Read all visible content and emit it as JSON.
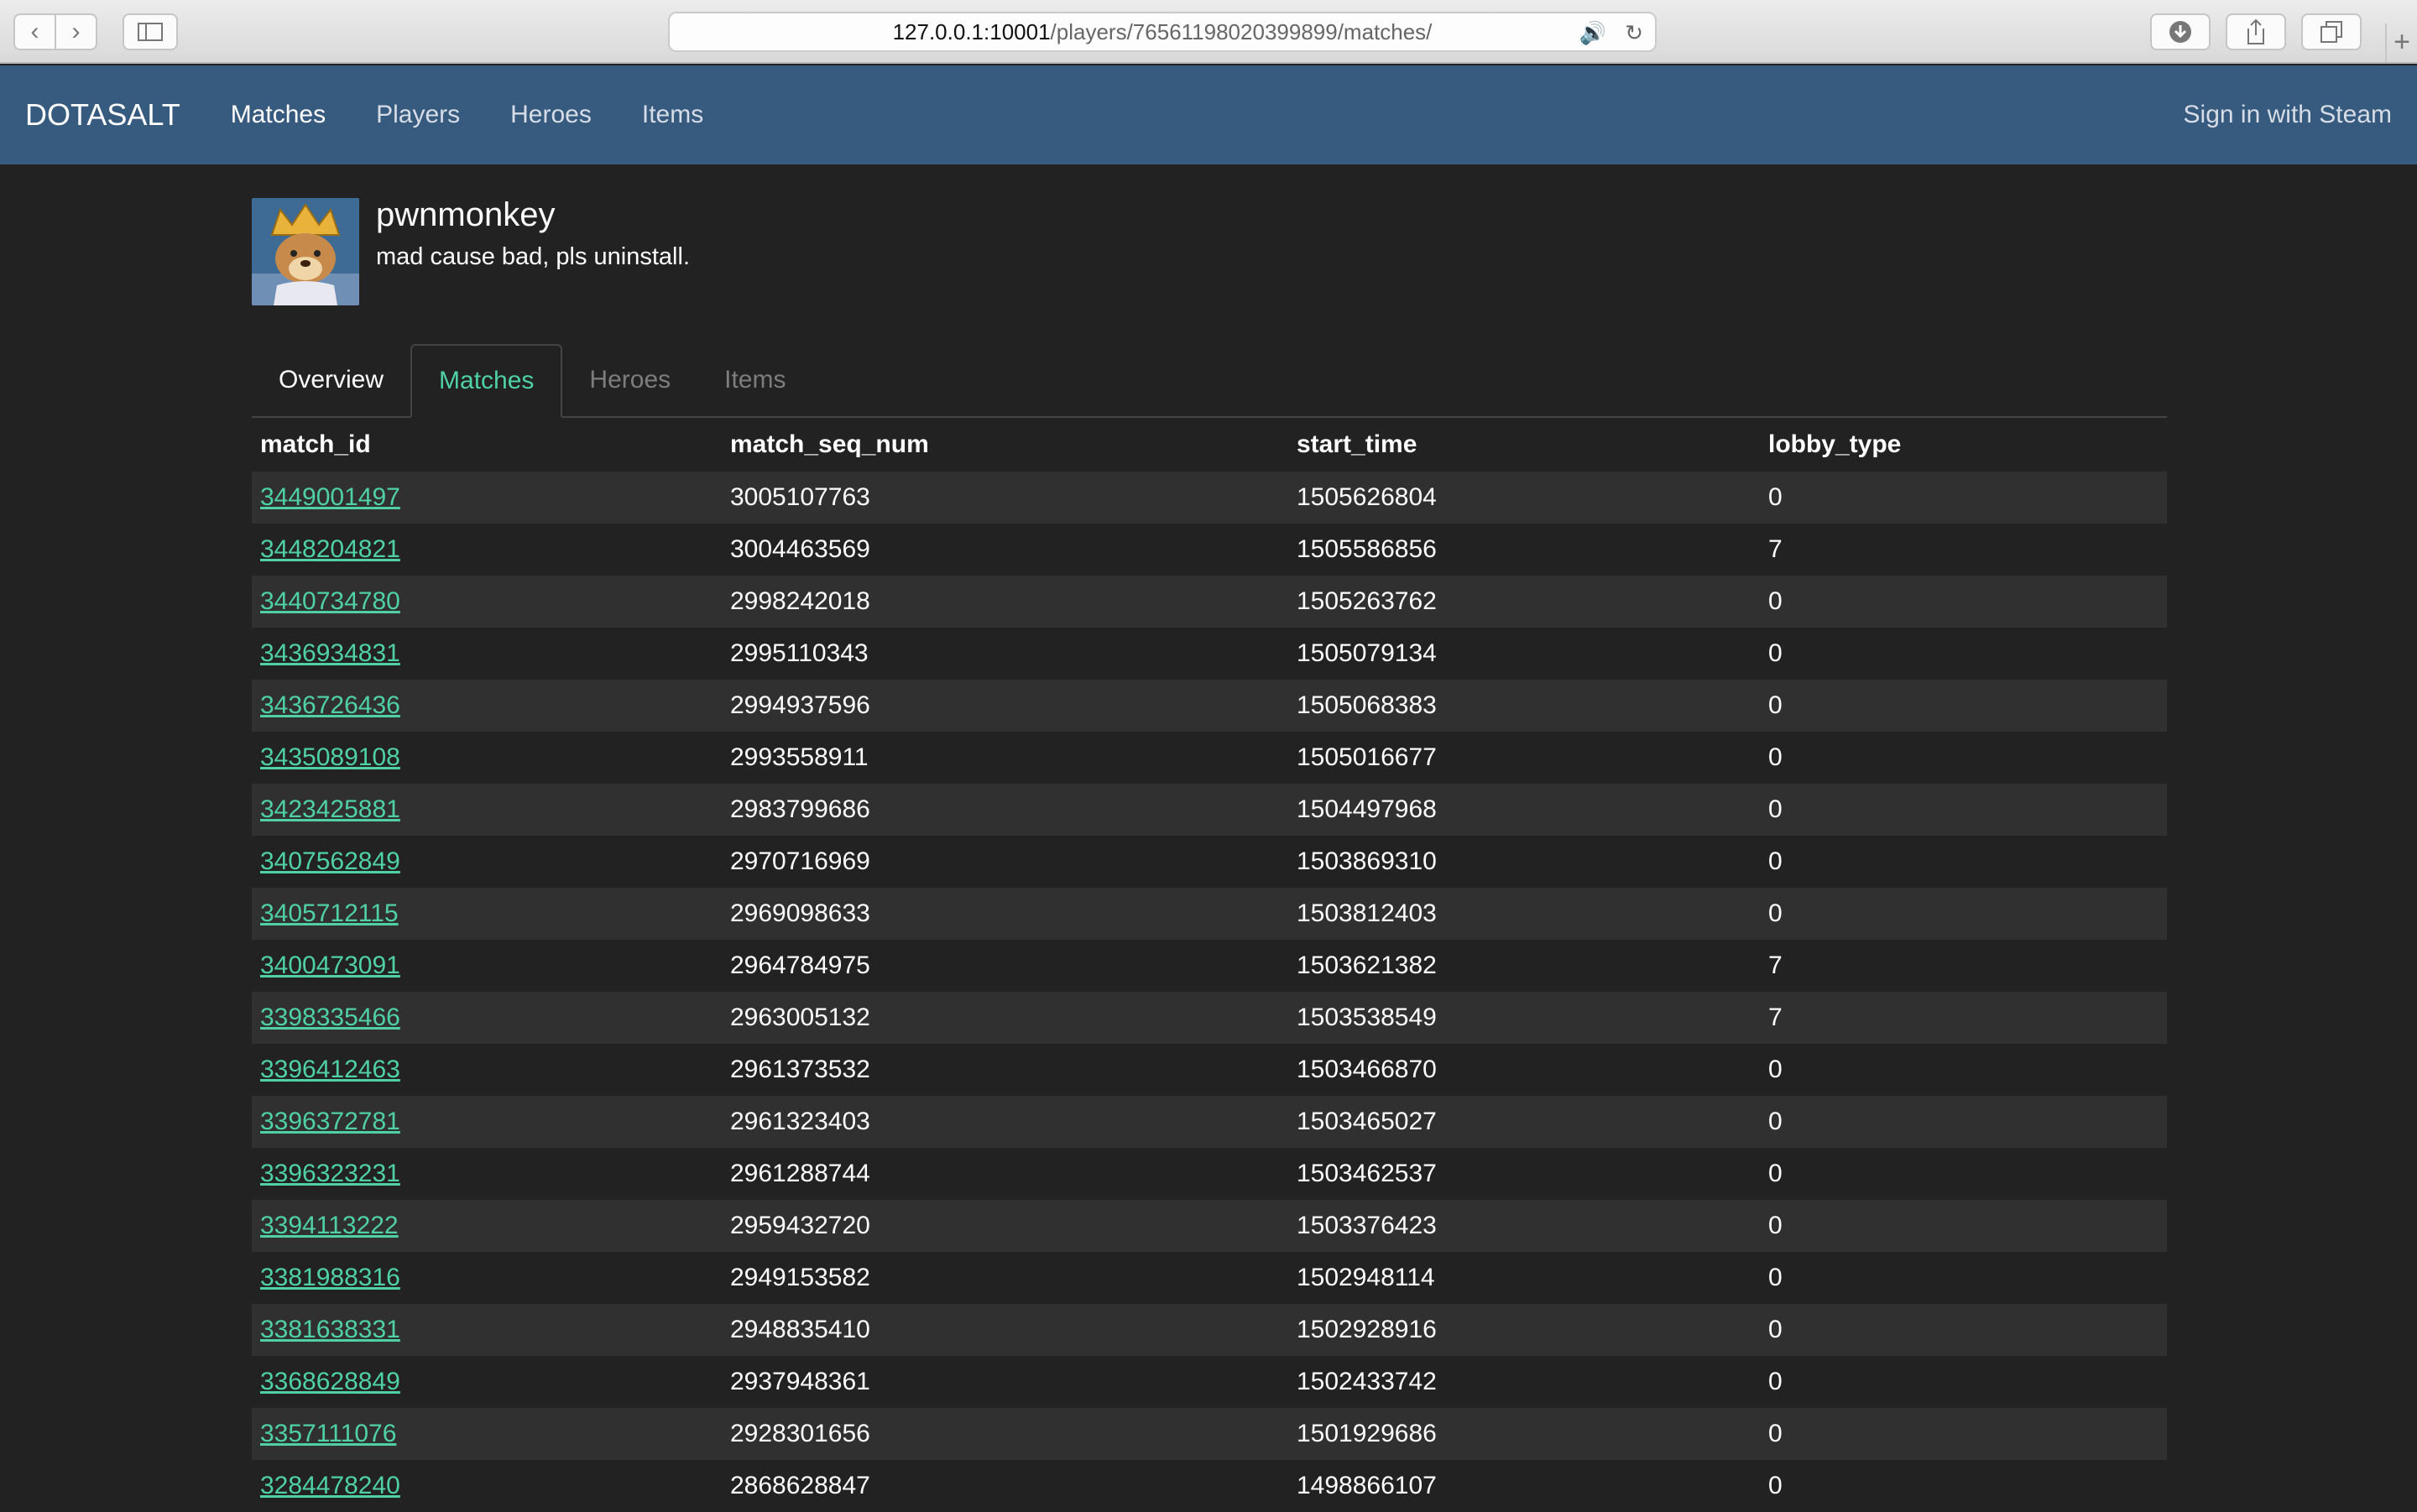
{
  "browser": {
    "url_host": "127.0.0.1:10001",
    "url_path": "/players/76561198020399899/matches/"
  },
  "navbar": {
    "brand": "DOTASALT",
    "links": [
      "Matches",
      "Players",
      "Heroes",
      "Items"
    ],
    "signin": "Sign in with Steam"
  },
  "profile": {
    "name": "pwnmonkey",
    "status": "mad cause bad, pls uninstall."
  },
  "tabs": [
    "Overview",
    "Matches",
    "Heroes",
    "Items"
  ],
  "table": {
    "columns": [
      "match_id",
      "match_seq_num",
      "start_time",
      "lobby_type"
    ],
    "rows": [
      [
        "3449001497",
        "3005107763",
        "1505626804",
        "0"
      ],
      [
        "3448204821",
        "3004463569",
        "1505586856",
        "7"
      ],
      [
        "3440734780",
        "2998242018",
        "1505263762",
        "0"
      ],
      [
        "3436934831",
        "2995110343",
        "1505079134",
        "0"
      ],
      [
        "3436726436",
        "2994937596",
        "1505068383",
        "0"
      ],
      [
        "3435089108",
        "2993558911",
        "1505016677",
        "0"
      ],
      [
        "3423425881",
        "2983799686",
        "1504497968",
        "0"
      ],
      [
        "3407562849",
        "2970716969",
        "1503869310",
        "0"
      ],
      [
        "3405712115",
        "2969098633",
        "1503812403",
        "0"
      ],
      [
        "3400473091",
        "2964784975",
        "1503621382",
        "7"
      ],
      [
        "3398335466",
        "2963005132",
        "1503538549",
        "7"
      ],
      [
        "3396412463",
        "2961373532",
        "1503466870",
        "0"
      ],
      [
        "3396372781",
        "2961323403",
        "1503465027",
        "0"
      ],
      [
        "3396323231",
        "2961288744",
        "1503462537",
        "0"
      ],
      [
        "3394113222",
        "2959432720",
        "1503376423",
        "0"
      ],
      [
        "3381988316",
        "2949153582",
        "1502948114",
        "0"
      ],
      [
        "3381638331",
        "2948835410",
        "1502928916",
        "0"
      ],
      [
        "3368628849",
        "2937948361",
        "1502433742",
        "0"
      ],
      [
        "3357111076",
        "2928301656",
        "1501929686",
        "0"
      ],
      [
        "3284478240",
        "2868628847",
        "1498866107",
        "0"
      ]
    ]
  }
}
